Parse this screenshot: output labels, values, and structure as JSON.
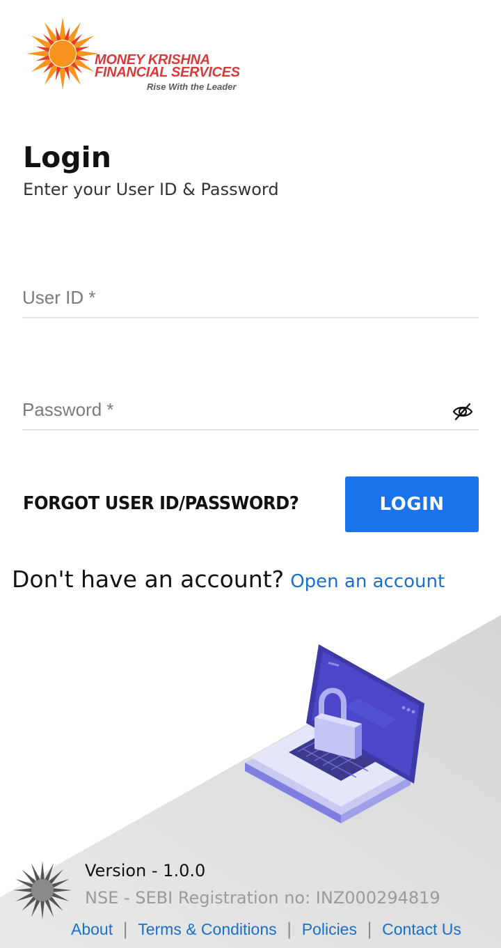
{
  "brand": {
    "name_line1": "MONEY KRISHNA",
    "name_line2": "FINANCIAL SERVICES",
    "tagline": "Rise With the Leader"
  },
  "login": {
    "title": "Login",
    "subtitle": "Enter your User ID & Password",
    "user_id_placeholder": "User ID *",
    "user_id_value": "",
    "password_placeholder": "Password *",
    "password_value": "",
    "password_toggle_icon": "eye-off-icon",
    "forgot_label": "FORGOT USER ID/PASSWORD?",
    "login_button": "LOGIN"
  },
  "signup": {
    "question": "Don't have an account?",
    "link": "Open an account"
  },
  "illustration": {
    "icon": "laptop-lock-illustration"
  },
  "footer": {
    "version": "Version - 1.0.0",
    "registration": "NSE - SEBI Registration no: INZ000294819",
    "links": [
      "About",
      "Terms & Conditions",
      "Policies",
      "Contact Us"
    ]
  },
  "colors": {
    "accent": "#1a73e8",
    "link": "#1a6fc9",
    "brand_red": "#d63a3a",
    "sun_orange": "#f7941d",
    "background_wedge": "#dedede"
  }
}
